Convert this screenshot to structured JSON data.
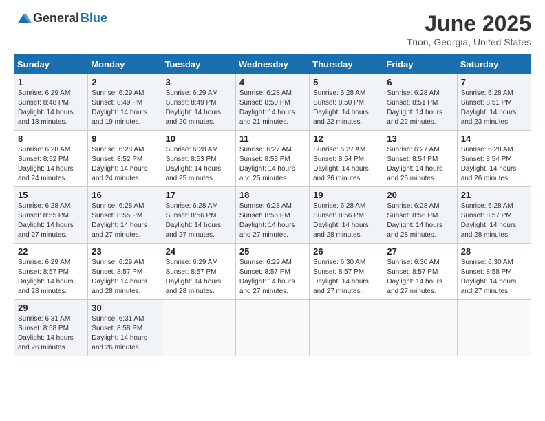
{
  "logo": {
    "general": "General",
    "blue": "Blue"
  },
  "title": {
    "month": "June 2025",
    "location": "Trion, Georgia, United States"
  },
  "calendar": {
    "headers": [
      "Sunday",
      "Monday",
      "Tuesday",
      "Wednesday",
      "Thursday",
      "Friday",
      "Saturday"
    ],
    "weeks": [
      [
        {
          "day": "1",
          "info": "Sunrise: 6:29 AM\nSunset: 8:48 PM\nDaylight: 14 hours\nand 18 minutes."
        },
        {
          "day": "2",
          "info": "Sunrise: 6:29 AM\nSunset: 8:49 PM\nDaylight: 14 hours\nand 19 minutes."
        },
        {
          "day": "3",
          "info": "Sunrise: 6:29 AM\nSunset: 8:49 PM\nDaylight: 14 hours\nand 20 minutes."
        },
        {
          "day": "4",
          "info": "Sunrise: 6:28 AM\nSunset: 8:50 PM\nDaylight: 14 hours\nand 21 minutes."
        },
        {
          "day": "5",
          "info": "Sunrise: 6:28 AM\nSunset: 8:50 PM\nDaylight: 14 hours\nand 22 minutes."
        },
        {
          "day": "6",
          "info": "Sunrise: 6:28 AM\nSunset: 8:51 PM\nDaylight: 14 hours\nand 22 minutes."
        },
        {
          "day": "7",
          "info": "Sunrise: 6:28 AM\nSunset: 8:51 PM\nDaylight: 14 hours\nand 23 minutes."
        }
      ],
      [
        {
          "day": "8",
          "info": "Sunrise: 6:28 AM\nSunset: 8:52 PM\nDaylight: 14 hours\nand 24 minutes."
        },
        {
          "day": "9",
          "info": "Sunrise: 6:28 AM\nSunset: 8:52 PM\nDaylight: 14 hours\nand 24 minutes."
        },
        {
          "day": "10",
          "info": "Sunrise: 6:28 AM\nSunset: 8:53 PM\nDaylight: 14 hours\nand 25 minutes."
        },
        {
          "day": "11",
          "info": "Sunrise: 6:27 AM\nSunset: 8:53 PM\nDaylight: 14 hours\nand 25 minutes."
        },
        {
          "day": "12",
          "info": "Sunrise: 6:27 AM\nSunset: 8:54 PM\nDaylight: 14 hours\nand 26 minutes."
        },
        {
          "day": "13",
          "info": "Sunrise: 6:27 AM\nSunset: 8:54 PM\nDaylight: 14 hours\nand 26 minutes."
        },
        {
          "day": "14",
          "info": "Sunrise: 6:28 AM\nSunset: 8:54 PM\nDaylight: 14 hours\nand 26 minutes."
        }
      ],
      [
        {
          "day": "15",
          "info": "Sunrise: 6:28 AM\nSunset: 8:55 PM\nDaylight: 14 hours\nand 27 minutes."
        },
        {
          "day": "16",
          "info": "Sunrise: 6:28 AM\nSunset: 8:55 PM\nDaylight: 14 hours\nand 27 minutes."
        },
        {
          "day": "17",
          "info": "Sunrise: 6:28 AM\nSunset: 8:56 PM\nDaylight: 14 hours\nand 27 minutes."
        },
        {
          "day": "18",
          "info": "Sunrise: 6:28 AM\nSunset: 8:56 PM\nDaylight: 14 hours\nand 27 minutes."
        },
        {
          "day": "19",
          "info": "Sunrise: 6:28 AM\nSunset: 8:56 PM\nDaylight: 14 hours\nand 28 minutes."
        },
        {
          "day": "20",
          "info": "Sunrise: 6:28 AM\nSunset: 8:56 PM\nDaylight: 14 hours\nand 28 minutes."
        },
        {
          "day": "21",
          "info": "Sunrise: 6:28 AM\nSunset: 8:57 PM\nDaylight: 14 hours\nand 28 minutes."
        }
      ],
      [
        {
          "day": "22",
          "info": "Sunrise: 6:29 AM\nSunset: 8:57 PM\nDaylight: 14 hours\nand 28 minutes."
        },
        {
          "day": "23",
          "info": "Sunrise: 6:29 AM\nSunset: 8:57 PM\nDaylight: 14 hours\nand 28 minutes."
        },
        {
          "day": "24",
          "info": "Sunrise: 6:29 AM\nSunset: 8:57 PM\nDaylight: 14 hours\nand 28 minutes."
        },
        {
          "day": "25",
          "info": "Sunrise: 6:29 AM\nSunset: 8:57 PM\nDaylight: 14 hours\nand 27 minutes."
        },
        {
          "day": "26",
          "info": "Sunrise: 6:30 AM\nSunset: 8:57 PM\nDaylight: 14 hours\nand 27 minutes."
        },
        {
          "day": "27",
          "info": "Sunrise: 6:30 AM\nSunset: 8:57 PM\nDaylight: 14 hours\nand 27 minutes."
        },
        {
          "day": "28",
          "info": "Sunrise: 6:30 AM\nSunset: 8:58 PM\nDaylight: 14 hours\nand 27 minutes."
        }
      ],
      [
        {
          "day": "29",
          "info": "Sunrise: 6:31 AM\nSunset: 8:58 PM\nDaylight: 14 hours\nand 26 minutes."
        },
        {
          "day": "30",
          "info": "Sunrise: 6:31 AM\nSunset: 8:58 PM\nDaylight: 14 hours\nand 26 minutes."
        },
        {
          "day": "",
          "info": ""
        },
        {
          "day": "",
          "info": ""
        },
        {
          "day": "",
          "info": ""
        },
        {
          "day": "",
          "info": ""
        },
        {
          "day": "",
          "info": ""
        }
      ]
    ]
  }
}
